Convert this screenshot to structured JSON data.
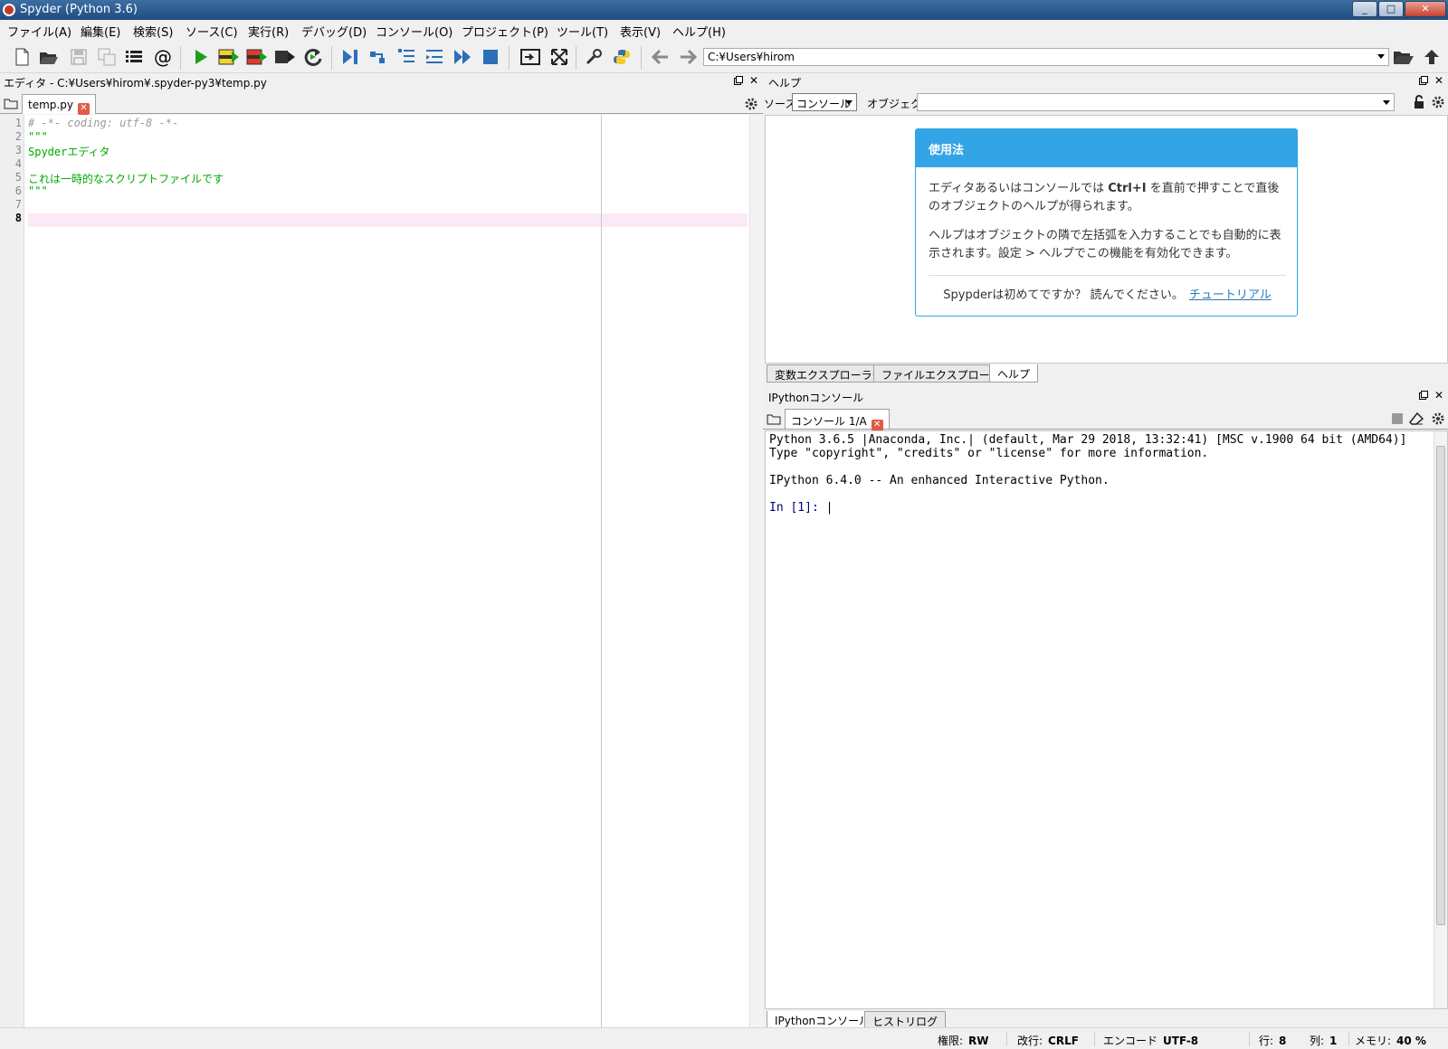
{
  "window": {
    "title": "Spyder (Python 3.6)",
    "minimize": "_",
    "maximize": "□",
    "close": "✕"
  },
  "menu": [
    "ファイル(A)",
    "編集(E)",
    "検索(S)",
    "ソース(C)",
    "実行(R)",
    "デバッグ(D)",
    "コンソール(O)",
    "プロジェクト(P)",
    "ツール(T)",
    "表示(V)",
    "ヘルプ(H)"
  ],
  "toolbar": {
    "icons": [
      "new-file-icon",
      "open-file-icon",
      "save-icon",
      "save-all-icon",
      "outline-icon",
      "at-icon",
      "run-icon",
      "run-cell-icon",
      "run-cell-advance-icon",
      "run-selection-icon",
      "rerun-icon",
      "debug-icon",
      "step-icon",
      "step-into-icon",
      "step-return-icon",
      "continue-icon",
      "stop-icon",
      "maximize-pane-icon",
      "fullscreen-icon",
      "preferences-icon",
      "python-path-icon",
      "back-icon",
      "forward-icon",
      "browse-folder-icon",
      "parent-dir-icon"
    ],
    "at_glyph": "@",
    "working_dir": "C:¥Users¥hirom"
  },
  "editor": {
    "pane_title": "エディタ - C:¥Users¥hirom¥.spyder-py3¥temp.py",
    "tab_label": "temp.py",
    "line_numbers": [
      "1",
      "2",
      "3",
      "4",
      "5",
      "6",
      "7",
      "8"
    ],
    "lines": [
      "# -*- coding: utf-8 -*-",
      "\"\"\"",
      "Spyderエディタ",
      "",
      "これは一時的なスクリプトファイルです",
      "\"\"\"",
      "",
      ""
    ]
  },
  "help": {
    "pane_title": "ヘルプ",
    "source_label": "ソース",
    "source_value": "コンソール",
    "object_label": "オブジェクト",
    "object_value": "",
    "usage_title": "使用法",
    "usage_p1_a": "エディタあるいはコンソールでは ",
    "usage_p1_key": "Ctrl+I",
    "usage_p1_b": " を直前で押すことで直後のオブジェクトのヘルプが得られます。",
    "usage_p2": "ヘルプはオブジェクトの隣で左括弧を入力することでも自動的に表示されます。設定 > ヘルプでこの機能を有効化できます。",
    "footer_text": "Spypderは初めてですか？ 読んでください。",
    "footer_link": "チュートリアル",
    "tabs": [
      "変数エクスプローラー",
      "ファイルエクスプローラー",
      "ヘルプ"
    ]
  },
  "console": {
    "pane_title": "IPythonコンソール",
    "tab_label": "コンソール 1/A",
    "lines": [
      "Python 3.6.5 |Anaconda, Inc.| (default, Mar 29 2018, 13:32:41) [MSC v.1900 64 bit (AMD64)]",
      "Type \"copyright\", \"credits\" or \"license\" for more information.",
      "",
      "IPython 6.4.0 -- An enhanced Interactive Python.",
      ""
    ],
    "prompt": "In [1]: ",
    "tabs": [
      "IPythonコンソール",
      "ヒストリログ"
    ]
  },
  "status": {
    "permissions_label": "権限:",
    "permissions": "RW",
    "eol_label": "改行:",
    "eol": "CRLF",
    "encoding_label": "エンコード",
    "encoding": "UTF-8",
    "line_label": "行:",
    "line": "8",
    "col_label": "列:",
    "col": "1",
    "memory_label": "メモリ:",
    "memory": "40 %"
  }
}
